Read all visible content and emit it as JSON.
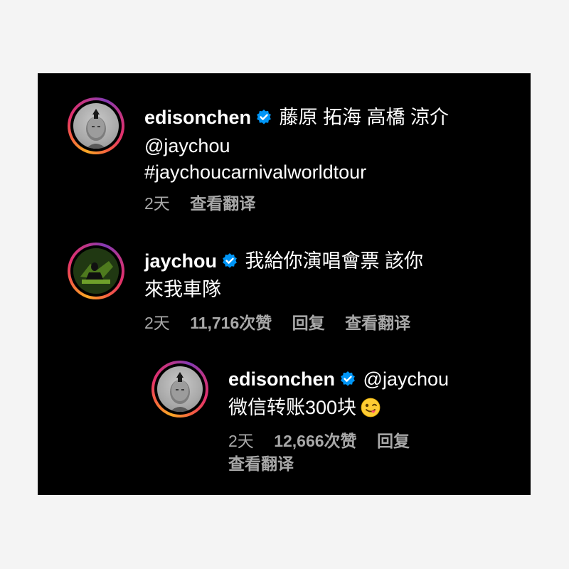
{
  "comments": [
    {
      "username": "edisonchen",
      "text_line1": "藤原 拓海 高橋 涼介",
      "text_line2": "@jaychou",
      "text_line3": "#jaychoucarnivalworldtour",
      "time": "2天",
      "translate": "查看翻译"
    },
    {
      "username": "jaychou",
      "text_line1": "我給你演唱會票 該你",
      "text_line2": "來我車隊",
      "time": "2天",
      "likes": "11,716次赞",
      "reply": "回复",
      "translate": "查看翻译"
    },
    {
      "username": "edisonchen",
      "mention": "@jaychou",
      "text_line2": "微信转账300块",
      "emoji": "winking-face-with-tongue",
      "time": "2天",
      "likes": "12,666次赞",
      "reply": "回复",
      "translate": "查看翻译"
    }
  ],
  "colors": {
    "background": "#000000",
    "page": "#f4f4f4",
    "text": "#ffffff",
    "meta": "#a8a8a8",
    "verified": "#0095f6"
  }
}
